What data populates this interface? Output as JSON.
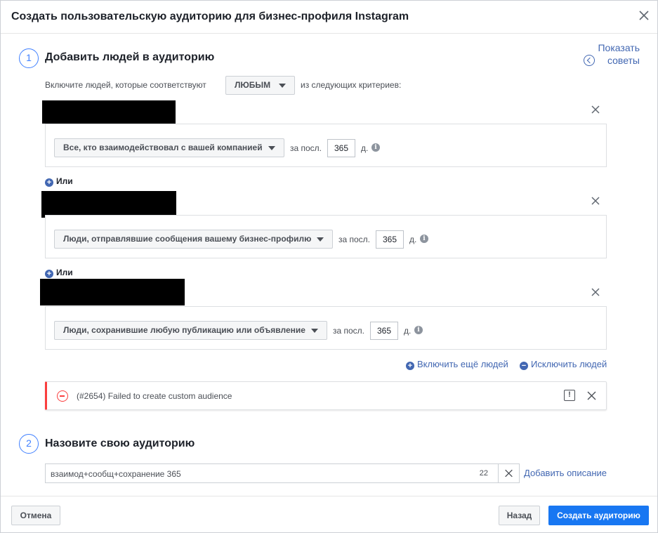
{
  "dialog": {
    "title": "Создать пользовательскую аудиторию для бизнес-профиля Instagram"
  },
  "step1": {
    "number": "1",
    "title": "Добавить людей в аудиторию",
    "tips_line1": "Показать",
    "tips_line2": "советы",
    "criteria_before": "Включите людей, которые соответствуют",
    "match_value": "ЛЮБЫМ",
    "criteria_after": "из следующих критериев:",
    "rules": [
      {
        "event": "Все, кто взаимодействовал с вашей компанией",
        "period_label": "за посл.",
        "days": "365",
        "unit": "д."
      },
      {
        "event": "Люди, отправлявшие сообщения вашему бизнес-профилю",
        "period_label": "за посл.",
        "days": "365",
        "unit": "д."
      },
      {
        "event": "Люди, сохранившие любую публикацию или объявление",
        "period_label": "за посл.",
        "days": "365",
        "unit": "д."
      }
    ],
    "or_label": "Или",
    "include_more": "Включить ещё людей",
    "exclude": "Исключить людей",
    "error": "(#2654) Failed to create custom audience"
  },
  "step2": {
    "number": "2",
    "title": "Назовите свою аудиторию",
    "name_value": "взаимод+сообщ+сохранение 365",
    "char_count": "22",
    "add_description": "Добавить описание"
  },
  "footer": {
    "cancel": "Отмена",
    "back": "Назад",
    "create": "Создать аудиторию"
  },
  "colors": {
    "accent": "#4267b2",
    "primary_button": "#1877f2",
    "error": "#fa3e3e"
  }
}
